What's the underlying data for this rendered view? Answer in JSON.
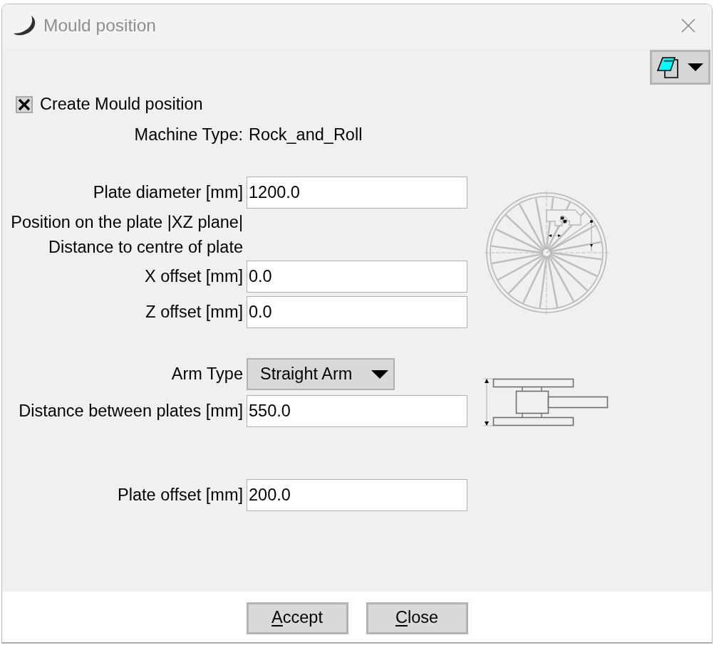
{
  "window": {
    "title": "Mould position"
  },
  "options": {
    "create": {
      "label": "Create Mould position",
      "checked": true
    }
  },
  "machine": {
    "label": "Machine Type:",
    "value": "Rock_and_Roll"
  },
  "sections": [
    {
      "kind": "wheel",
      "rows": [
        {
          "kind": "input",
          "label": "Plate diameter [mm]",
          "value": "1200.0"
        },
        {
          "kind": "note",
          "label": "Position on the plate |XZ plane|"
        },
        {
          "kind": "note",
          "label": "Distance to centre of plate"
        },
        {
          "kind": "input",
          "label": "X offset [mm]",
          "value": "0.0"
        },
        {
          "kind": "input",
          "label": "Z offset [mm]",
          "value": "0.0"
        }
      ]
    },
    {
      "kind": "arm",
      "rows": [
        {
          "kind": "dropdown",
          "label": "Arm Type",
          "value": "Straight Arm"
        },
        {
          "kind": "input",
          "label": "Distance between plates [mm]",
          "value": "550.0"
        }
      ]
    },
    {
      "kind": "plain",
      "rows": [
        {
          "kind": "input",
          "label": "Plate offset [mm]",
          "value": "200.0"
        }
      ]
    }
  ],
  "buttons": [
    {
      "label": "Accept",
      "access_key": true
    },
    {
      "label": "Close",
      "access_key": true
    }
  ]
}
